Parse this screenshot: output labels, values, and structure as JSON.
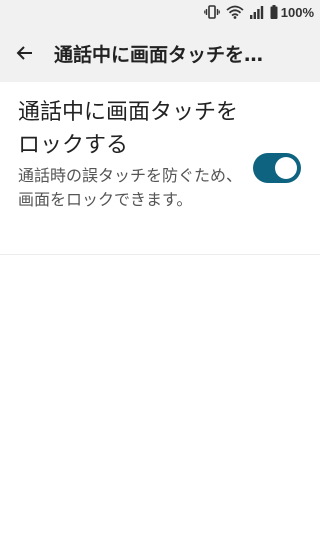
{
  "status_bar": {
    "battery_text": "100%",
    "icons": [
      "vibrate-icon",
      "wifi-icon",
      "signal-icon",
      "battery-icon"
    ]
  },
  "app_bar": {
    "title": "通話中に画面タッチを…",
    "back_icon": "arrow-back-icon"
  },
  "setting": {
    "title": "通話中に画面タッチをロックする",
    "summary": "通話時の誤タッチを防ぐため、画面をロックできます。",
    "enabled": true
  },
  "colors": {
    "accent": "#0e6480",
    "app_bar_bg": "#f1f1f1",
    "text_primary": "#222222",
    "text_secondary": "#555555"
  }
}
